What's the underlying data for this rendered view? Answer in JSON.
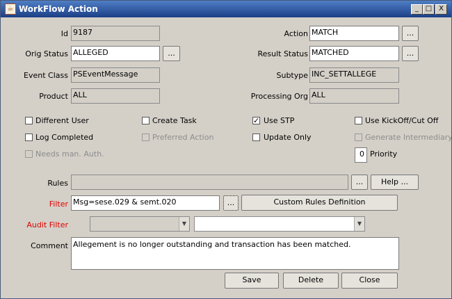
{
  "window": {
    "title": "WorkFlow Action",
    "minimize": "_",
    "maximize": "□",
    "close": "X"
  },
  "fields": {
    "id": {
      "label": "Id",
      "value": "9187"
    },
    "orig_status": {
      "label": "Orig Status",
      "value": "ALLEGED"
    },
    "event_class": {
      "label": "Event Class",
      "value": "PSEventMessage"
    },
    "product": {
      "label": "Product",
      "value": "ALL"
    },
    "action": {
      "label": "Action",
      "value": "MATCH"
    },
    "result_status": {
      "label": "Result Status",
      "value": "MATCHED"
    },
    "subtype": {
      "label": "Subtype",
      "value": "INC_SETTALLEGE"
    },
    "processing_org": {
      "label": "Processing Org",
      "value": "ALL"
    }
  },
  "ellipsis": "...",
  "checkboxes": {
    "different_user": {
      "label": "Different User",
      "checked": false,
      "enabled": true
    },
    "create_task": {
      "label": "Create Task",
      "checked": false,
      "enabled": true
    },
    "use_stp": {
      "label": "Use STP",
      "checked": true,
      "enabled": true
    },
    "use_kickoff": {
      "label": "Use KickOff/Cut Off",
      "checked": false,
      "enabled": true
    },
    "log_completed": {
      "label": "Log Completed",
      "checked": false,
      "enabled": true
    },
    "preferred_action": {
      "label": "Preferred Action",
      "checked": false,
      "enabled": false
    },
    "update_only": {
      "label": "Update Only",
      "checked": false,
      "enabled": true
    },
    "generate_intermediary": {
      "label": "Generate Intermediary Ev",
      "checked": false,
      "enabled": false
    },
    "needs_man_auth": {
      "label": "Needs man. Auth.",
      "checked": false,
      "enabled": false
    }
  },
  "check_mark": "✓",
  "priority": {
    "label": "Priority",
    "value": "0"
  },
  "rules": {
    "label": "Rules",
    "value": "",
    "help_label": "Help ..."
  },
  "filter": {
    "label": "Filter",
    "value": "Msg=sese.029 & semt.020",
    "custom_label": "Custom Rules Definition"
  },
  "audit_filter": {
    "label": "Audit Filter",
    "value1": "",
    "value2": ""
  },
  "comment": {
    "label": "Comment",
    "value": "Allegement is no longer outstanding and transaction has been matched."
  },
  "buttons": {
    "save": "Save",
    "delete": "Delete",
    "close": "Close"
  },
  "colors": {
    "title_gradient_top": "#4f7ec4",
    "title_gradient_bottom": "#1b3f87",
    "background": "#d4d0c8",
    "required_label": "#e00000",
    "disabled_text": "#8c8c8c"
  }
}
